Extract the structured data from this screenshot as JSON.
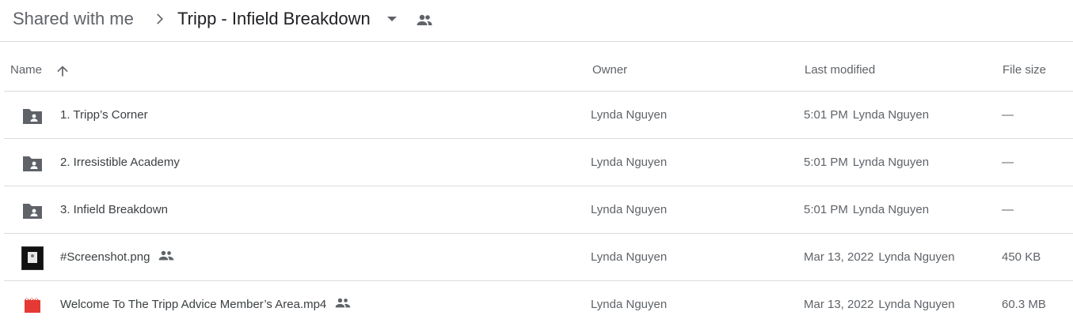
{
  "breadcrumb": {
    "root_label": "Shared with me",
    "current_label": "Tripp - Infield Breakdown"
  },
  "columns": {
    "name": "Name",
    "owner": "Owner",
    "last_modified": "Last modified",
    "file_size": "File size"
  },
  "files": [
    {
      "icon": "shared-folder-icon",
      "name": "1. Tripp’s Corner",
      "shared": false,
      "owner": "Lynda Nguyen",
      "modified_time": "5:01 PM",
      "modified_by": "Lynda Nguyen",
      "size": "—"
    },
    {
      "icon": "shared-folder-icon",
      "name": "2. Irresistible Academy",
      "shared": false,
      "owner": "Lynda Nguyen",
      "modified_time": "5:01 PM",
      "modified_by": "Lynda Nguyen",
      "size": "—"
    },
    {
      "icon": "shared-folder-icon",
      "name": "3. Infield Breakdown",
      "shared": false,
      "owner": "Lynda Nguyen",
      "modified_time": "5:01 PM",
      "modified_by": "Lynda Nguyen",
      "size": "—"
    },
    {
      "icon": "image-thumbnail-icon",
      "name": "#Screenshot.png",
      "shared": true,
      "owner": "Lynda Nguyen",
      "modified_time": "Mar 13, 2022",
      "modified_by": "Lynda Nguyen",
      "size": "450 KB"
    },
    {
      "icon": "video-file-icon",
      "name": "Welcome To The Tripp Advice Member’s Area.mp4",
      "shared": true,
      "owner": "Lynda Nguyen",
      "modified_time": "Mar 13, 2022",
      "modified_by": "Lynda Nguyen",
      "size": "60.3 MB"
    }
  ],
  "colors": {
    "folder_icon": "#5f6368",
    "video_icon": "#e53935",
    "divider": "#dadce0",
    "primary_text": "#3c4043",
    "secondary_text": "#5f6368"
  }
}
